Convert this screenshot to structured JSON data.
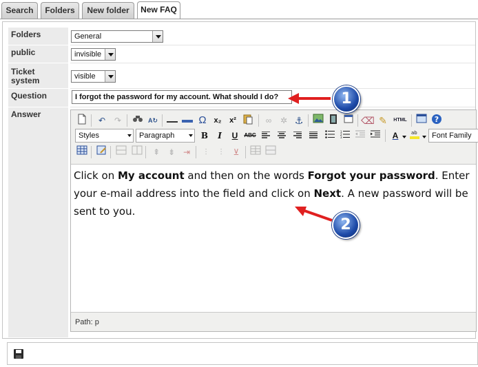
{
  "tabs": [
    {
      "label": "Search"
    },
    {
      "label": "Folders"
    },
    {
      "label": "New folder"
    },
    {
      "label": "New FAQ"
    }
  ],
  "form": {
    "folders": {
      "label": "Folders",
      "value": "General"
    },
    "public": {
      "label": "public",
      "value": "invisible"
    },
    "ticket_system": {
      "label": "Ticket system",
      "value": "visible"
    },
    "question": {
      "label": "Question",
      "value": "I forgot the password for my account. What should I do?"
    },
    "answer": {
      "label": "Answer",
      "styles_value": "Styles",
      "format_value": "Paragraph",
      "font_family_value": "Font Family",
      "html_button": "HTML",
      "content": {
        "t1": "Click on ",
        "b1": "My account",
        "t2": " and then on the words ",
        "b2": "Forgot your password",
        "t3": ". Enter your e-mail address into the field and click on ",
        "b3": "Next",
        "t4": ". A new password will be sent to you."
      },
      "path": "Path: p"
    }
  },
  "callouts": [
    {
      "number": "1"
    },
    {
      "number": "2"
    }
  ],
  "colors": {
    "arrow": "#e02020",
    "callout": "#1d4aa8"
  }
}
